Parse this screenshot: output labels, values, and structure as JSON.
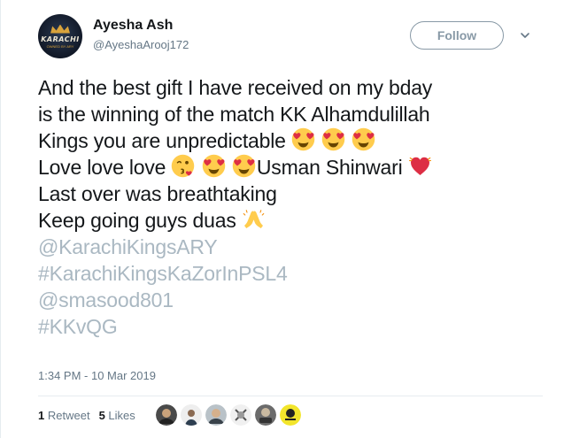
{
  "author": {
    "name": "Ayesha Ash",
    "handle": "@AyeshaArooj172",
    "avatar_text": "KARACHI",
    "avatar_subtext": "OWNED BY ARY"
  },
  "follow_button": {
    "label": "Follow"
  },
  "tweet": {
    "lines": [
      "And the best gift I have received on my bday",
      "is the winning of the match KK Alhamdulillah",
      "Kings you are unpredictable",
      "Love love love",
      "Usman Shinwari",
      "Last over was breathtaking",
      "Keep going guys duas",
      "@KarachiKingsARY",
      "#KarachiKingsKaZorInPSL4",
      "@smasood801",
      "#KKvQG"
    ]
  },
  "timestamp": "1:34 PM - 10 Mar 2019",
  "stats": {
    "retweet_count": "1",
    "retweet_label": "Retweet",
    "like_count": "5",
    "like_label": "Likes"
  },
  "colors": {
    "link": "#aab8c2",
    "secondary": "#657786",
    "border": "#e6ecf0"
  }
}
